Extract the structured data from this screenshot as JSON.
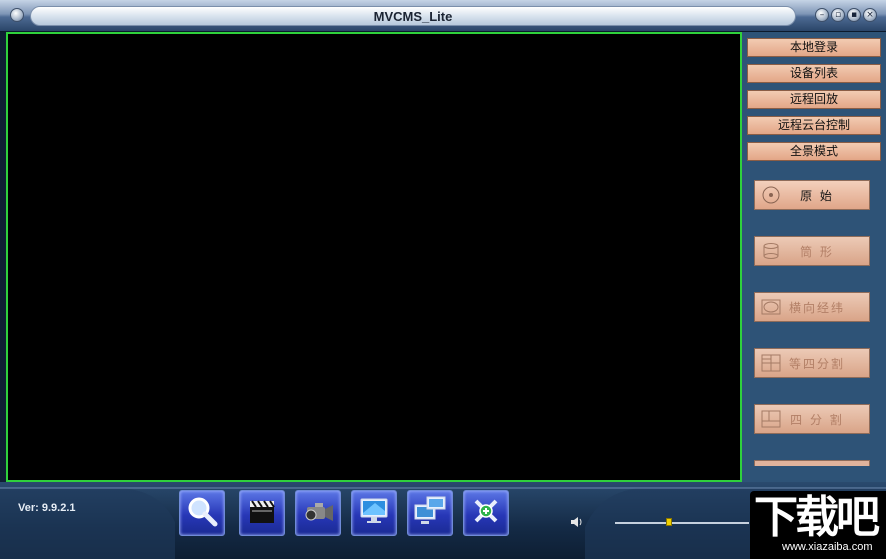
{
  "window": {
    "title": "MVCMS_Lite",
    "controls": [
      "minimize",
      "restore",
      "maximize",
      "close"
    ]
  },
  "menu": [
    {
      "label": "本地登录"
    },
    {
      "label": "设备列表"
    },
    {
      "label": "远程回放"
    },
    {
      "label": "远程云台控制"
    },
    {
      "label": "全景模式"
    }
  ],
  "view_modes": [
    {
      "label": "原 始",
      "icon": "disc-icon",
      "state": "active"
    },
    {
      "label": "筒 形",
      "icon": "cylinder-icon",
      "state": "disabled"
    },
    {
      "label": "横向经纬",
      "icon": "ellipse-icon",
      "state": "disabled"
    },
    {
      "label": "等四分割",
      "icon": "grid-four-icon",
      "state": "disabled"
    },
    {
      "label": "四 分 割",
      "icon": "quad-split-icon",
      "state": "disabled"
    }
  ],
  "footer": {
    "version": "Ver: 9.9.2.1",
    "tools": [
      "search-icon",
      "clapperboard-icon",
      "camcorder-icon",
      "monitor-icon",
      "network-monitor-icon",
      "settings-tools-icon"
    ],
    "volume_icon": "speaker-icon",
    "volume_level": 0.4
  },
  "watermark": {
    "main": "下载吧",
    "sub": "www.xiazaiba.com"
  },
  "colors": {
    "video_border": "#2fd13c",
    "panel_bg": "#2e5377",
    "button_bg": "#e3a687",
    "tool_bg": "#2737b7"
  }
}
